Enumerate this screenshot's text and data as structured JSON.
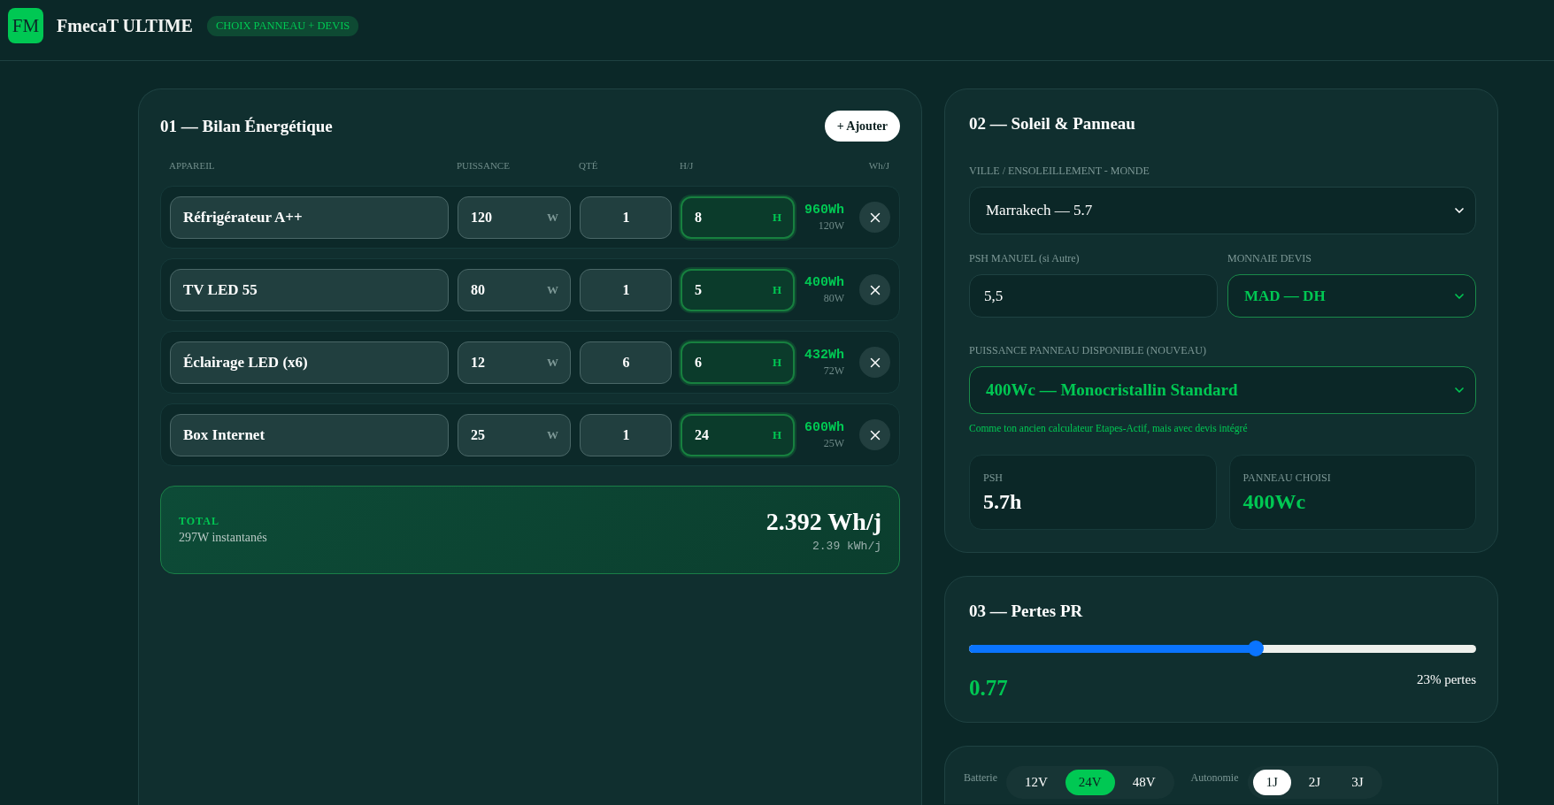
{
  "header": {
    "logo": "FM",
    "title": "FmecaT ULTIME",
    "badge": "CHOIX PANNEAU + DEVIS"
  },
  "energy": {
    "title": "01 — Bilan Énergétique",
    "add_button": "+ Ajouter",
    "columns": [
      "APPAREIL",
      "PUISSANCE",
      "QTÉ",
      "H/J",
      "Wh/J"
    ],
    "rows": [
      {
        "name": "Réfrigérateur A++",
        "power": "120",
        "power_unit": "W",
        "qty": "1",
        "hours": "8",
        "hours_unit": "H",
        "energy": "960Wh",
        "load": "120W"
      },
      {
        "name": "TV LED 55",
        "power": "80",
        "power_unit": "W",
        "qty": "1",
        "hours": "5",
        "hours_unit": "H",
        "energy": "400Wh",
        "load": "80W"
      },
      {
        "name": "Éclairage LED (x6)",
        "power": "12",
        "power_unit": "W",
        "qty": "6",
        "hours": "6",
        "hours_unit": "H",
        "energy": "432Wh",
        "load": "72W"
      },
      {
        "name": "Box Internet",
        "power": "25",
        "power_unit": "W",
        "qty": "1",
        "hours": "24",
        "hours_unit": "H",
        "energy": "600Wh",
        "load": "25W"
      }
    ],
    "total": {
      "label": "TOTAL",
      "instant": "297W instantanés",
      "value": "2.392 Wh/j",
      "kwh": "2.39 kWh/j"
    }
  },
  "sun_panel": {
    "title": "02 — Soleil & Panneau",
    "city": {
      "label": "VILLE / ENSOLEILLEMENT - MONDE",
      "value": "Marrakech — 5.7",
      "accent": false
    },
    "psh_manual": {
      "label": "PSH MANUEL (si Autre)",
      "value": "5,5"
    },
    "currency": {
      "label": "MONNAIE DEVIS",
      "value": "MAD — DH",
      "accent": true
    },
    "panel_power": {
      "label": "PUISSANCE PANNEAU DISPONIBLE (NOUVEAU)",
      "value": "400Wc — Monocristallin Standard",
      "accent": true,
      "note": "Comme ton ancien calculateur Etapes-Actif, mais avec devis intégré"
    },
    "stats": [
      {
        "label": "PSH",
        "value": "5.7h",
        "accent": false
      },
      {
        "label": "PANNEAU CHOISI",
        "value": "400Wc",
        "accent": true
      }
    ]
  },
  "losses": {
    "title": "03 — Pertes PR",
    "level": 0.565,
    "value": "0.77",
    "reading": "23% pertes"
  },
  "options": {
    "groups": [
      {
        "label": "Batterie",
        "kind": "primary",
        "options": [
          {
            "label": "12V",
            "selected": false
          },
          {
            "label": "24V",
            "selected": true
          },
          {
            "label": "48V",
            "selected": false
          }
        ]
      },
      {
        "label": "Autonomie",
        "kind": "neutral",
        "options": [
          {
            "label": "1J",
            "selected": true
          },
          {
            "label": "2J",
            "selected": false
          },
          {
            "label": "3J",
            "selected": false
          }
        ]
      }
    ]
  }
}
